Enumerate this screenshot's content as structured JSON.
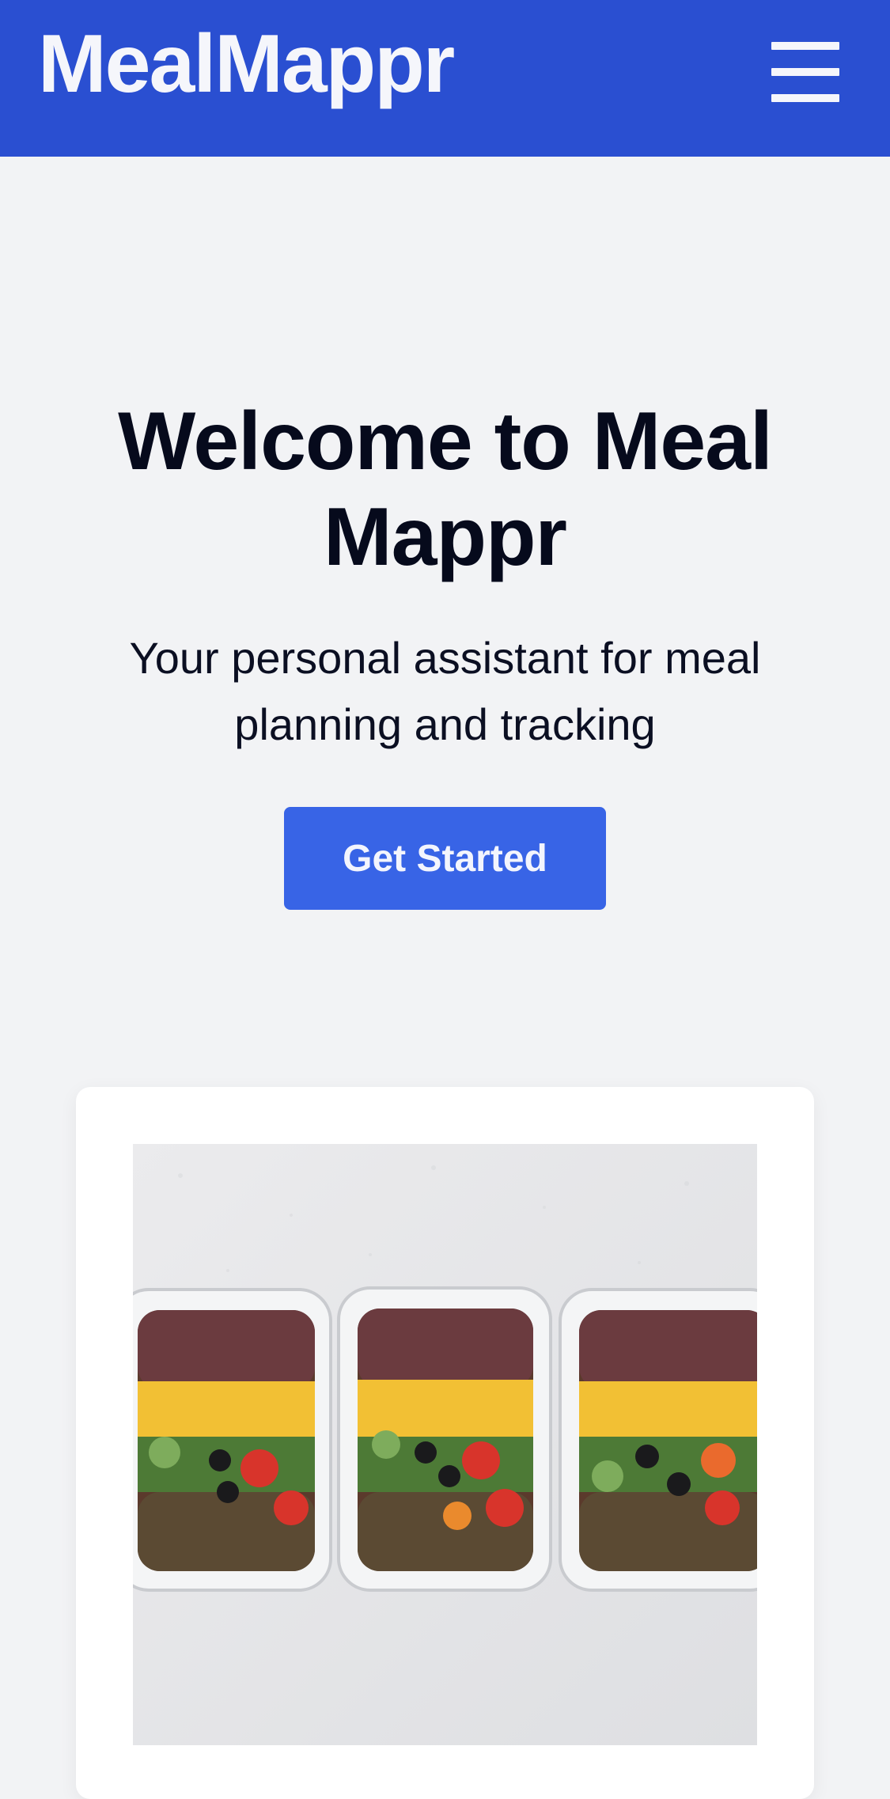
{
  "header": {
    "brand": "MealMappr",
    "menu_icon": "hamburger-menu-icon",
    "background_color": "#2a4fd1"
  },
  "hero": {
    "title": "Welcome to Meal Mappr",
    "subtitle": "Your personal assistant for meal planning and tracking",
    "cta_label": "Get Started",
    "cta_color": "#3864e6"
  },
  "card": {
    "image": "meal-prep-containers-photo"
  }
}
